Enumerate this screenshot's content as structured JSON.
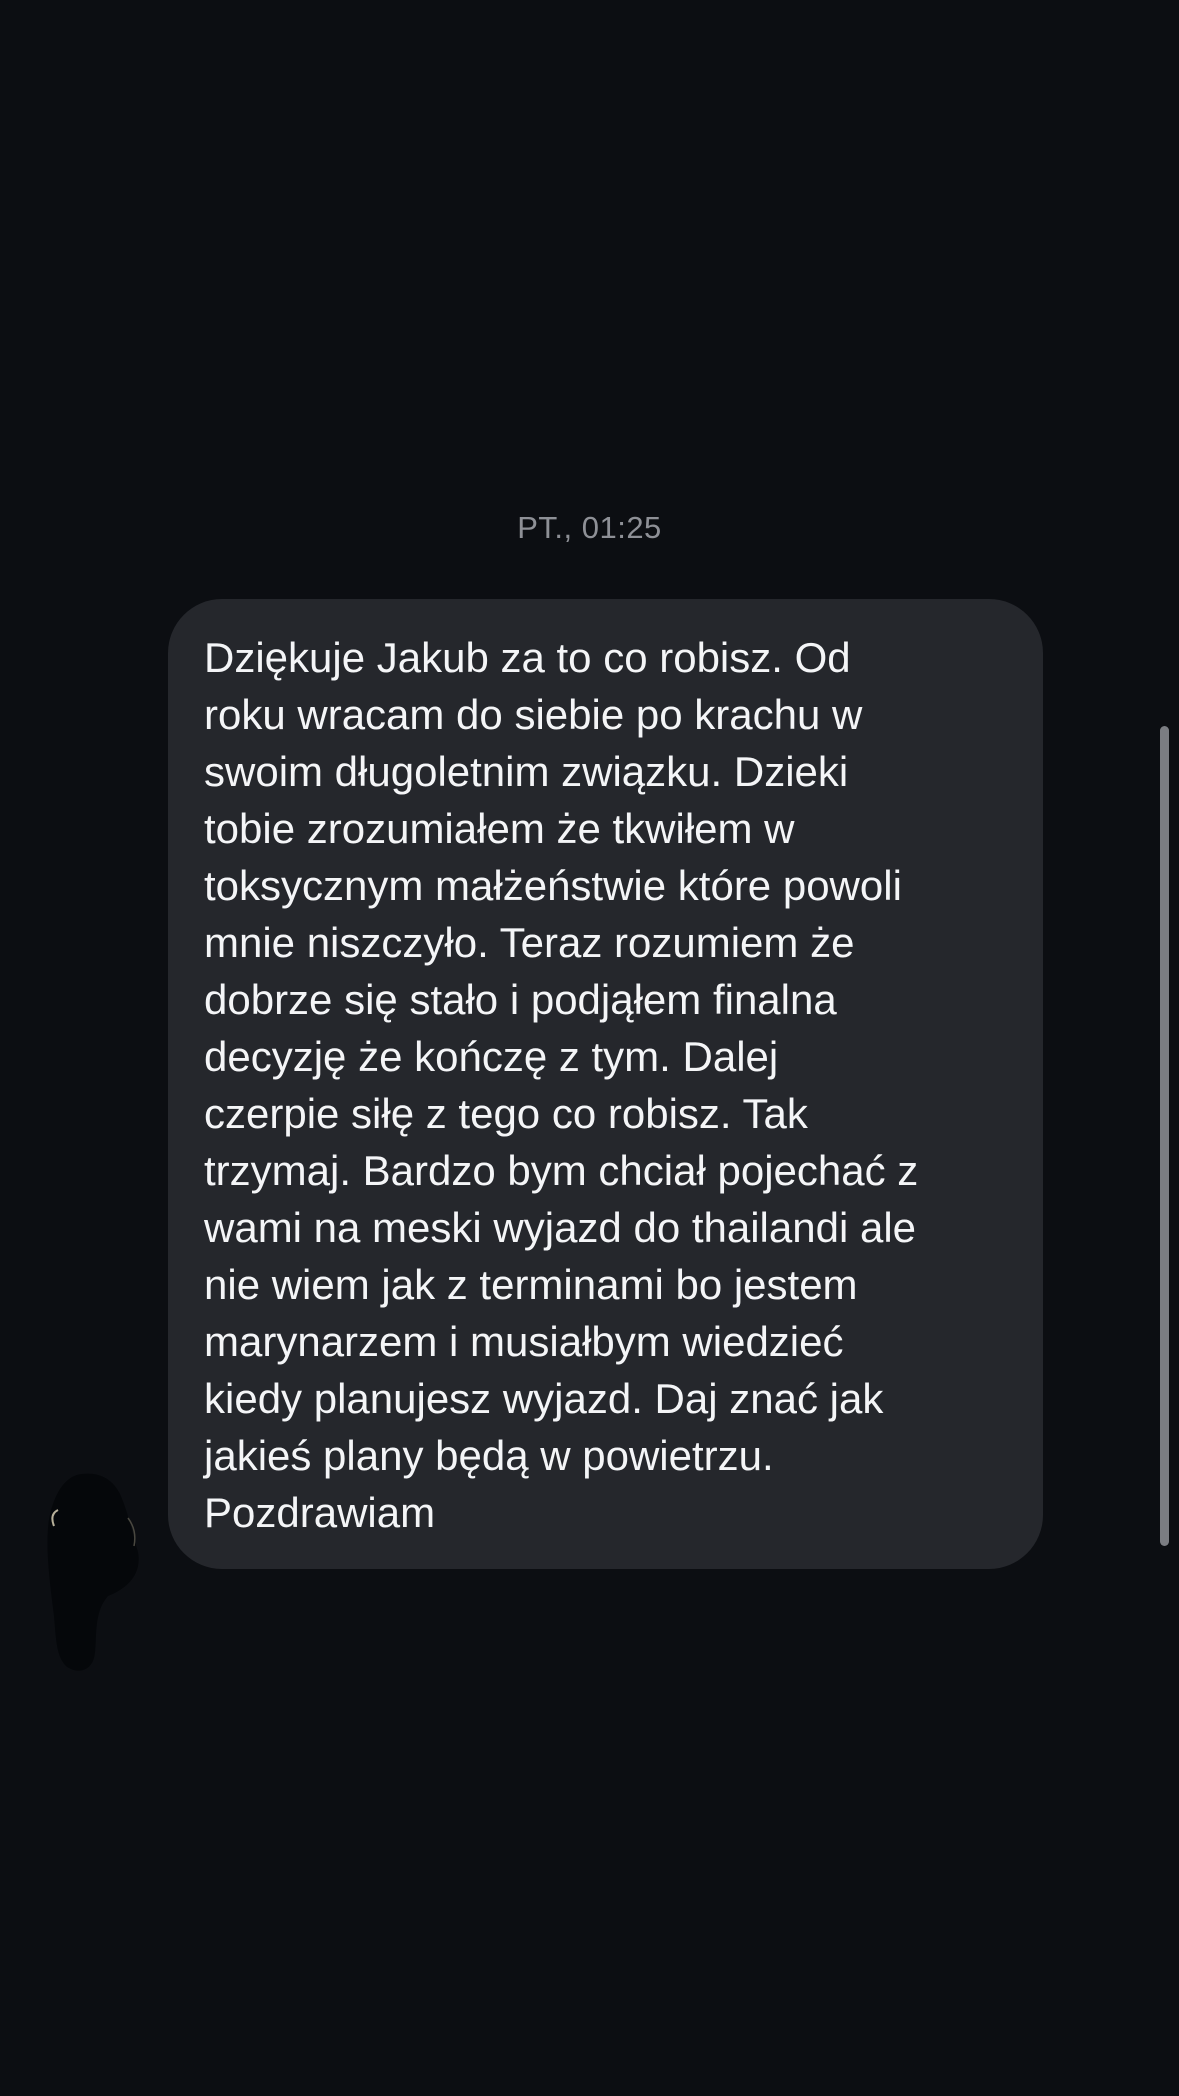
{
  "conversation": {
    "timestamp": "PT., 01:25",
    "message": {
      "text": "Dziękuje Jakub za to co robisz. Od\nroku wracam do siebie po krachu w\nswoim długoletnim związku. Dzieki\ntobie zrozumiałem że tkwiłem w\ntoksycznym małżeństwie które powoli\nmnie niszczyło. Teraz rozumiem że\ndobrze się stało i podjąłem finalna\ndecyzję że kończę z tym. Dalej\nczerpie siłę z tego co robisz. Tak\ntrzymaj. Bardzo bym chciał pojechać z\nwami na meski wyjazd do thailandi ale\nnie wiem jak z terminami bo jestem\nmarynarzem i musiałbym wiedzieć\nkiedy planujesz wyjazd. Daj znać jak\njakieś plany będą w powietrzu.\nPozdrawiam",
      "direction": "incoming"
    },
    "sender_avatar": {
      "icon": "avatar-icon",
      "obscured": true
    }
  },
  "colors": {
    "background": "#0c0e12",
    "bubble": "#25272c",
    "message_text": "#f4f5f7",
    "timestamp_text": "#8e9096",
    "scrollbar": "#7b7d82"
  },
  "scroll": {
    "thumb_fraction": 0.44
  }
}
